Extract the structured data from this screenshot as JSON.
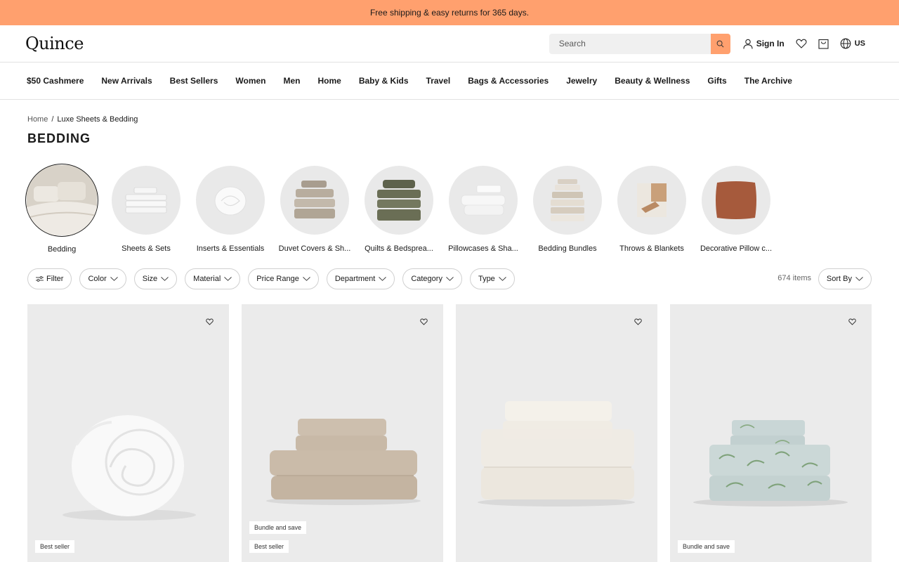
{
  "promo": {
    "text": "Free shipping & easy returns for 365 days."
  },
  "header": {
    "logo": "Quince",
    "search_placeholder": "Search",
    "signin_label": "Sign In",
    "locale": "US"
  },
  "nav": {
    "items": [
      "$50 Cashmere",
      "New Arrivals",
      "Best Sellers",
      "Women",
      "Men",
      "Home",
      "Baby & Kids",
      "Travel",
      "Bags & Accessories",
      "Jewelry",
      "Beauty & Wellness",
      "Gifts",
      "The Archive"
    ]
  },
  "breadcrumb": {
    "home": "Home",
    "separator": "/",
    "current": "Luxe Sheets & Bedding"
  },
  "page_title": "BEDDING",
  "categories": [
    {
      "label": "Bedding",
      "active": true
    },
    {
      "label": "Sheets & Sets"
    },
    {
      "label": "Inserts & Essentials"
    },
    {
      "label": "Duvet Covers & Sh..."
    },
    {
      "label": "Quilts & Bedsprea..."
    },
    {
      "label": "Pillowcases & Sha..."
    },
    {
      "label": "Bedding Bundles"
    },
    {
      "label": "Throws & Blankets"
    },
    {
      "label": "Decorative Pillow c..."
    }
  ],
  "filters": {
    "filter_label": "Filter",
    "pills": [
      "Color",
      "Size",
      "Material",
      "Price Range",
      "Department",
      "Category",
      "Type"
    ],
    "item_count": "674 items",
    "sort_label": "Sort By"
  },
  "products": [
    {
      "badges": [
        "Best seller"
      ],
      "image": "rolled-duvet-insert"
    },
    {
      "badges": [
        "Bundle and save",
        "Best seller"
      ],
      "image": "taupe-sheet-stack"
    },
    {
      "badges": [],
      "image": "ivory-sheet-stack"
    },
    {
      "badges": [
        "Bundle and save"
      ],
      "image": "floral-sheet-stack"
    }
  ],
  "colors": {
    "promo_bg": "#ffa06e",
    "accent": "#ffa06e"
  }
}
